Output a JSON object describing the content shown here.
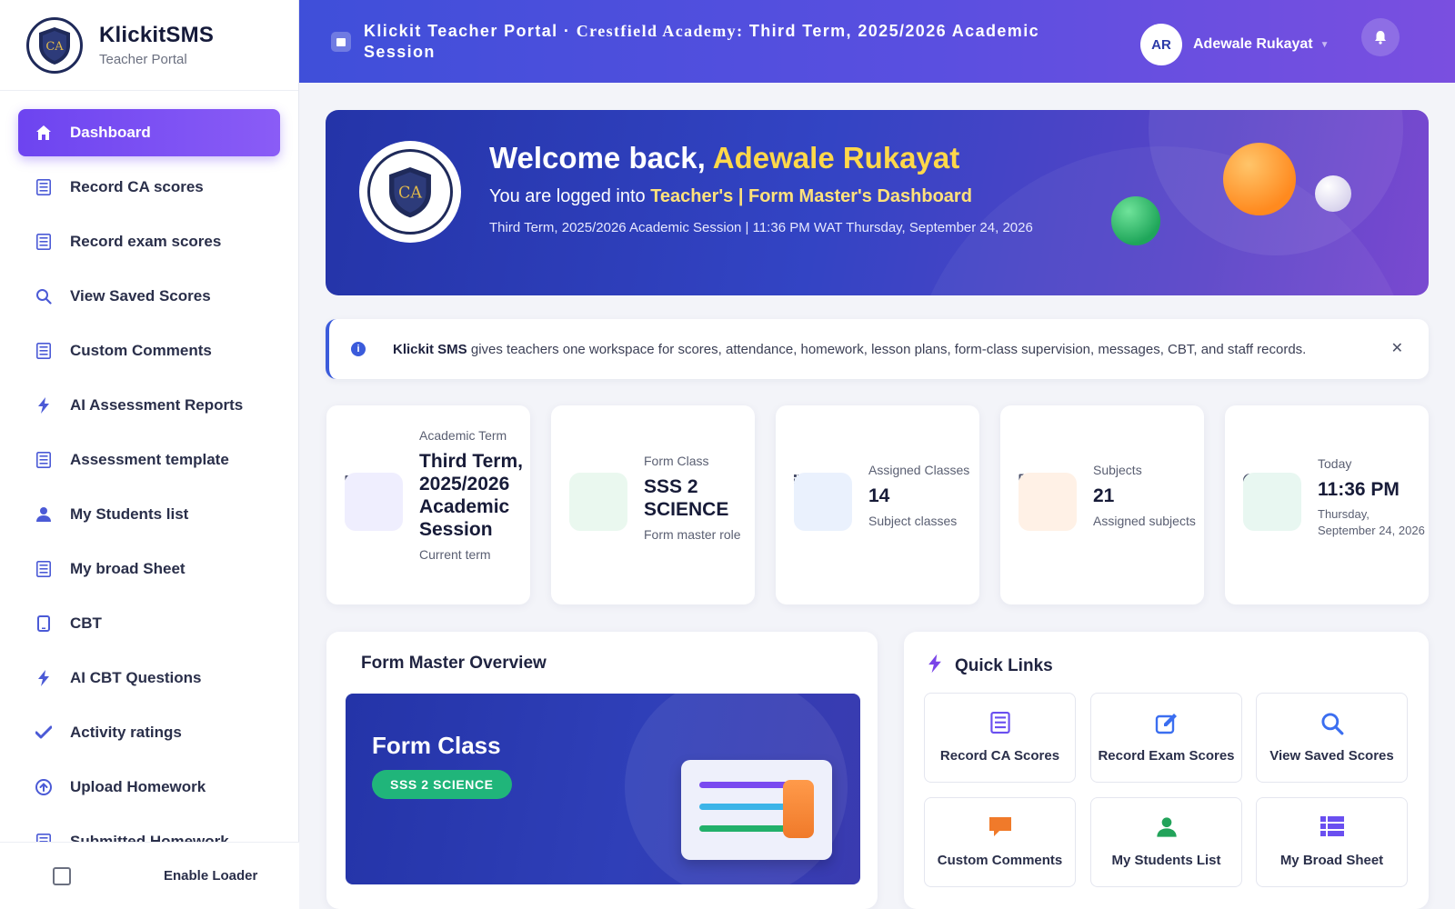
{
  "brand": {
    "name": "KlickitSMS",
    "subtitle": "Teacher Portal",
    "logo_text": "CA"
  },
  "sidebar": {
    "items": [
      {
        "label": "Dashboard",
        "icon": "home-icon",
        "active": true
      },
      {
        "label": "Record CA scores",
        "icon": "list-icon"
      },
      {
        "label": "Record exam scores",
        "icon": "list-icon"
      },
      {
        "label": "View Saved Scores",
        "icon": "search-icon"
      },
      {
        "label": "Custom Comments",
        "icon": "list-icon"
      },
      {
        "label": "AI Assessment Reports",
        "icon": "bolt-icon"
      },
      {
        "label": "Assessment template",
        "icon": "list-icon"
      },
      {
        "label": "My Students list",
        "icon": "user-icon"
      },
      {
        "label": "My broad Sheet",
        "icon": "list-icon"
      },
      {
        "label": "CBT",
        "icon": "tablet-icon"
      },
      {
        "label": "AI CBT Questions",
        "icon": "bolt-icon"
      },
      {
        "label": "Activity ratings",
        "icon": "check-icon"
      },
      {
        "label": "Upload Homework",
        "icon": "upload-icon"
      },
      {
        "label": "Submitted Homework",
        "icon": "list-icon"
      }
    ],
    "loader_label": "Enable Loader"
  },
  "topbar": {
    "title_prefix": "Klickit Teacher Portal · ",
    "title_school": "Crestfield Academy:",
    "title_suffix": " Third Term, 2025/2026 Academic Session",
    "user_initials": "AR",
    "user_name": "Adewale Rukayat"
  },
  "hero": {
    "greeting": "Welcome back, ",
    "name": "Adewale Rukayat",
    "sub_prefix": "You are logged into ",
    "sub_bold": "Teacher's | Form Master's Dashboard",
    "meta": "Third Term, 2025/2026 Academic Session | 11:36 PM WAT Thursday, September 24, 2026"
  },
  "info": {
    "brand": "Klickit SMS",
    "text": " gives teachers one workspace for scores, attendance, homework, lesson plans, form-class supervision, messages, CBT, and staff records."
  },
  "stats": [
    {
      "label": "Academic Term",
      "value": "Third Term, 2025/2026 Academic Session",
      "foot": "Current term",
      "swatch": "#efeefe",
      "icon": "calendar-icon"
    },
    {
      "label": "Form Class",
      "value": "SSS 2 SCIENCE",
      "foot": "Form master role",
      "swatch": "#eaf8ef",
      "icon": ""
    },
    {
      "label": "Assigned Classes",
      "value": "14",
      "foot": "Subject classes",
      "swatch": "#eaf1fd",
      "icon": "list-icon"
    },
    {
      "label": "Subjects",
      "value": "21",
      "foot": "Assigned subjects",
      "swatch": "#fff1e6",
      "icon": "book-icon"
    },
    {
      "label": "Today",
      "value": "11:36 PM",
      "foot": "Thursday, September 24, 2026",
      "swatch": "#e8f7f1",
      "icon": "clock-icon"
    }
  ],
  "form_master": {
    "title": "Form Master Overview",
    "card_title": "Form Class",
    "class_name": "SSS 2 SCIENCE"
  },
  "quick_links": {
    "title": "Quick Links",
    "items": [
      {
        "label": "Record CA Scores",
        "icon": "list-icon",
        "color": "#6a4ff0"
      },
      {
        "label": "Record Exam Scores",
        "icon": "edit-icon",
        "color": "#3b6ef0"
      },
      {
        "label": "View Saved Scores",
        "icon": "search-icon",
        "color": "#3b6ef0"
      },
      {
        "label": "Custom Comments",
        "icon": "comment-icon",
        "color": "#f07a2a"
      },
      {
        "label": "My Students List",
        "icon": "user-icon",
        "color": "#22a35a"
      },
      {
        "label": "My Broad Sheet",
        "icon": "table-icon",
        "color": "#6a4ff0"
      }
    ]
  }
}
